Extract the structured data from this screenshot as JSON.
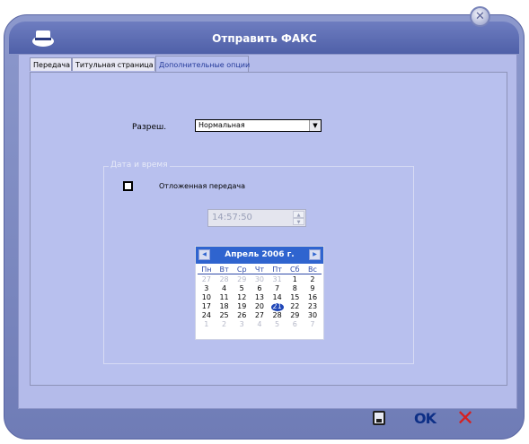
{
  "window": {
    "title": "Отправить ФАКС"
  },
  "tabs": [
    {
      "label": "Передача",
      "active": false
    },
    {
      "label": "Титульная страница",
      "active": false
    },
    {
      "label": "Дополнительные опции",
      "active": true
    }
  ],
  "resolution": {
    "label": "Разреш.",
    "value": "Нормальная"
  },
  "datetime": {
    "group_title": "Дата и время",
    "deferred_label": "Отложенная передача",
    "deferred_checked": false,
    "time_value": "14:57:50"
  },
  "calendar": {
    "title": "Апрель 2006 г.",
    "weekdays": [
      "Пн",
      "Вт",
      "Ср",
      "Чт",
      "Пт",
      "Сб",
      "Вс"
    ],
    "weeks": [
      [
        "27",
        "28",
        "29",
        "30",
        "31",
        "1",
        "2"
      ],
      [
        "3",
        "4",
        "5",
        "6",
        "7",
        "8",
        "9"
      ],
      [
        "10",
        "11",
        "12",
        "13",
        "14",
        "15",
        "16"
      ],
      [
        "17",
        "18",
        "19",
        "20",
        "21",
        "22",
        "23"
      ],
      [
        "24",
        "25",
        "26",
        "27",
        "28",
        "29",
        "30"
      ],
      [
        "1",
        "2",
        "3",
        "4",
        "5",
        "6",
        "7"
      ]
    ],
    "selected": "21",
    "colors": {
      "header": "#2f64cf",
      "selected": "#2047b8"
    }
  },
  "footer": {
    "ok_label": "OK",
    "cancel_icon": "close-x-icon",
    "save_icon": "floppy-disk-icon"
  },
  "colors": {
    "frame": "#8c98cc",
    "panel": "#b8c0ee",
    "ok": "#0d2f86",
    "cancel": "#d62020"
  }
}
